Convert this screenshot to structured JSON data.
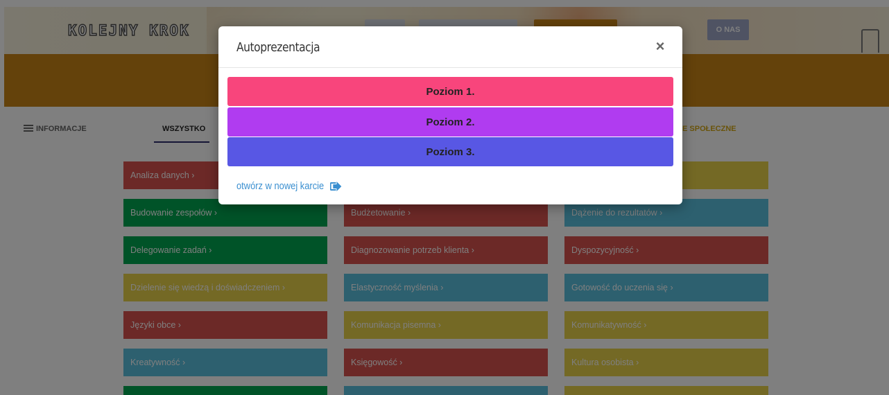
{
  "header": {
    "logo": "KOLEJNY KROK",
    "nav_about": "O NAS"
  },
  "tabs": {
    "info": "INFORMACJE",
    "all": "WSZYSTKO",
    "social_partial": "E SPOŁECZNE"
  },
  "colors": {
    "banner": "#c98516",
    "red": "#d9534f",
    "green": "#00a651",
    "yellow": "#e8d24a",
    "blue": "#5bc0de",
    "level1": "#f8457c",
    "level2": "#b03cf0",
    "level3": "#5857e4",
    "link": "#3a8fd0"
  },
  "skills": [
    {
      "label": "Analiza danych ›",
      "color": "red"
    },
    {
      "label": "",
      "color": "red"
    },
    {
      "label": "",
      "color": "yellow"
    },
    {
      "label": "Budowanie zespołów ›",
      "color": "green"
    },
    {
      "label": "Budżetowanie ›",
      "color": "red"
    },
    {
      "label": "Dążenie do rezultatów ›",
      "color": "blue"
    },
    {
      "label": "Delegowanie zadań ›",
      "color": "green"
    },
    {
      "label": "Diagnozowanie potrzeb klienta ›",
      "color": "red"
    },
    {
      "label": "Dyspozycyjność ›",
      "color": "red"
    },
    {
      "label": "Dzielenie się wiedzą i doświadczeniem ›",
      "color": "yellow"
    },
    {
      "label": "Elastyczność myślenia ›",
      "color": "blue"
    },
    {
      "label": "Gotowość do uczenia się ›",
      "color": "blue"
    },
    {
      "label": "Języki obce ›",
      "color": "red"
    },
    {
      "label": "Komunikacja pisemna ›",
      "color": "yellow"
    },
    {
      "label": "Komunikatywność ›",
      "color": "yellow"
    },
    {
      "label": "Kreatywność ›",
      "color": "blue"
    },
    {
      "label": "Księgowość ›",
      "color": "red"
    },
    {
      "label": "Kultura osobista ›",
      "color": "yellow"
    },
    {
      "label": "",
      "color": "green"
    },
    {
      "label": "",
      "color": "blue"
    },
    {
      "label": "",
      "color": "yellow"
    }
  ],
  "modal": {
    "title": "Autoprezentacja",
    "close_icon": "close-icon",
    "levels": [
      "Poziom 1.",
      "Poziom 2.",
      "Poziom 3."
    ],
    "open_link": "otwórz w nowej karcie",
    "open_icon": "sign-out-icon"
  }
}
